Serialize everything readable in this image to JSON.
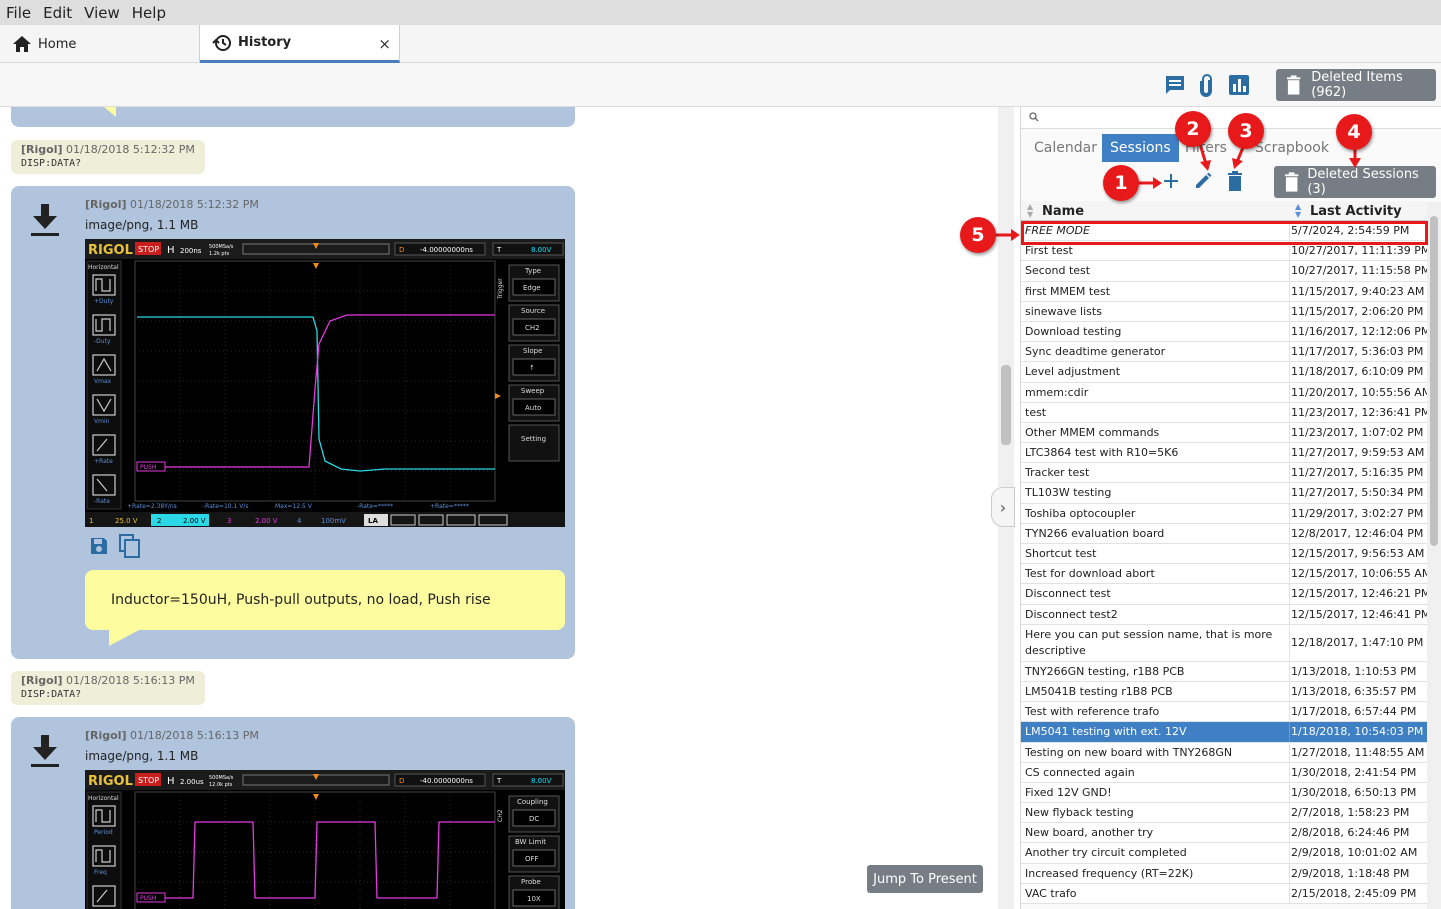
{
  "menu": [
    "File",
    "Edit",
    "View",
    "Help"
  ],
  "tabs": {
    "home": "Home",
    "history": "History",
    "close": "×"
  },
  "toolbar": {
    "deleted_items": "Deleted Items (962)"
  },
  "chat": {
    "cmd1": {
      "source": "[Rigol]",
      "time": "01/18/2018 5:12:32 PM",
      "text": "DISP:DATA?"
    },
    "img1": {
      "source": "[Rigol]",
      "time": "01/18/2018 5:12:32 PM",
      "type": "image/png, 1.1 MB",
      "note": "Inductor=150uH, Push-pull outputs, no load, Push rise"
    },
    "cmd2": {
      "source": "[Rigol]",
      "time": "01/18/2018 5:16:13 PM",
      "text": "DISP:DATA?"
    },
    "img2": {
      "source": "[Rigol]",
      "time": "01/18/2018 5:16:13 PM",
      "type": "image/png, 1.1 MB"
    },
    "jump": "Jump To Present"
  },
  "scope1": {
    "brand": "RIGOL",
    "stop": "STOP",
    "h": "H",
    "timebase": "200ns",
    "srate": "500MSa/s",
    "mem": "1.2k pts",
    "d": "D",
    "offset": "-4.00000000ns",
    "trig": "T",
    "tlevel": "8.00V",
    "left_menu": [
      "Horizontal",
      "+Duty",
      "-Duty",
      "Vmax",
      "Vmin",
      "+Rate",
      "-Rate"
    ],
    "right_menu": [
      [
        "Type",
        "Edge"
      ],
      [
        "Source",
        "CH2"
      ],
      [
        "Slope",
        "↑"
      ],
      [
        "Sweep",
        "Auto"
      ],
      [
        "Setting",
        ""
      ]
    ],
    "trigger_label": "Trigger",
    "push_label": "PUSH",
    "meas": [
      "+Rate=2.38Y/ns",
      "-Rate=10.1 V/s",
      "Max=12.5 V",
      "-Rate=*****",
      "+Rate=*****"
    ],
    "ch": [
      [
        "1",
        "25.0 V"
      ],
      [
        "2",
        "2.00 V"
      ],
      [
        "3",
        "2.00 V"
      ],
      [
        "4",
        "100mV"
      ]
    ],
    "la": "LA"
  },
  "scope2": {
    "brand": "RIGOL",
    "stop": "STOP",
    "h": "H",
    "timebase": "2.00us",
    "srate": "500MSa/s",
    "mem": "12.0k pts",
    "d": "D",
    "offset": "-40.0000000ns",
    "trig": "T",
    "tlevel": "8.00V",
    "left_menu": [
      "Horizontal",
      "Period",
      "Freq"
    ],
    "right_menu": [
      [
        "Coupling",
        "DC"
      ],
      [
        "BW Limit",
        "OFF"
      ],
      [
        "Probe",
        "10X"
      ]
    ],
    "ch2_label": "CH2",
    "push_label": "PUSH"
  },
  "sidebar": {
    "tabs": [
      "Calendar",
      "Sessions",
      "Filters",
      "Scrapbook"
    ],
    "deleted_sessions": "Deleted Sessions (3)",
    "columns": {
      "name": "Name",
      "activity": "Last Activity"
    },
    "rows": [
      [
        "FREE MODE",
        "5/7/2024, 2:54:59 PM"
      ],
      [
        "First test",
        "10/27/2017, 11:11:39 PM"
      ],
      [
        "Second test",
        "10/27/2017, 11:15:58 PM"
      ],
      [
        "first MMEM test",
        "11/15/2017, 9:40:23 AM"
      ],
      [
        "sinewave lists",
        "11/15/2017, 2:06:20 PM"
      ],
      [
        "Download testing",
        "11/16/2017, 12:12:06 PM"
      ],
      [
        "Sync deadtime generator",
        "11/17/2017, 5:36:03 PM"
      ],
      [
        "Level adjustment",
        "11/18/2017, 6:10:09 PM"
      ],
      [
        "mmem:cdir",
        "11/20/2017, 10:55:56 AM"
      ],
      [
        "test",
        "11/23/2017, 12:36:41 PM"
      ],
      [
        "Other MMEM commands",
        "11/23/2017, 1:07:02 PM"
      ],
      [
        "LTC3864 test with R10=5K6",
        "11/27/2017, 9:59:53 AM"
      ],
      [
        "Tracker test",
        "11/27/2017, 5:16:35 PM"
      ],
      [
        "TL103W testing",
        "11/27/2017, 5:50:34 PM"
      ],
      [
        "Toshiba optocoupler",
        "11/29/2017, 3:02:27 PM"
      ],
      [
        "TYN266 evaluation board",
        "12/8/2017, 12:46:04 PM"
      ],
      [
        "Shortcut test",
        "12/15/2017, 9:56:53 AM"
      ],
      [
        "Test for download abort",
        "12/15/2017, 10:06:55 AM"
      ],
      [
        "Disconnect test",
        "12/15/2017, 12:46:21 PM"
      ],
      [
        "Disconnect test2",
        "12/15/2017, 12:46:41 PM"
      ],
      [
        "Here you can put session name, that is more descriptive",
        "12/18/2017, 1:47:10 PM"
      ],
      [
        "TNY266GN testing, r1B8 PCB",
        "1/13/2018, 1:10:53 PM"
      ],
      [
        "LM5041B testing r1B8 PCB",
        "1/13/2018, 6:35:57 PM"
      ],
      [
        "Test with reference trafo",
        "1/17/2018, 6:57:44 PM"
      ],
      [
        "LM5041 testing with ext. 12V",
        "1/18/2018, 10:54:03 PM"
      ],
      [
        "Testing on new board with TNY268GN",
        "1/27/2018, 11:48:55 AM"
      ],
      [
        "CS connected again",
        "1/30/2018, 2:41:54 PM"
      ],
      [
        "Fixed 12V GND!",
        "1/30/2018, 6:50:13 PM"
      ],
      [
        "New flyback testing",
        "2/7/2018, 1:58:23 PM"
      ],
      [
        "New board, another try",
        "2/8/2018, 6:24:46 PM"
      ],
      [
        "Another try circuit completed",
        "2/9/2018, 10:01:02 AM"
      ],
      [
        "Increased frequency (RT=22K)",
        "2/9/2018, 1:18:48 PM"
      ],
      [
        "VAC trafo",
        "2/15/2018, 2:45:09 PM"
      ]
    ],
    "selected_index": 24
  },
  "callouts": [
    "1",
    "2",
    "3",
    "4",
    "5"
  ],
  "colors": {
    "accent": "#3f7fc3",
    "callout": "#e8191b",
    "bubble": "#b0c4de",
    "note": "#fdfda0",
    "button": "#767d84"
  }
}
